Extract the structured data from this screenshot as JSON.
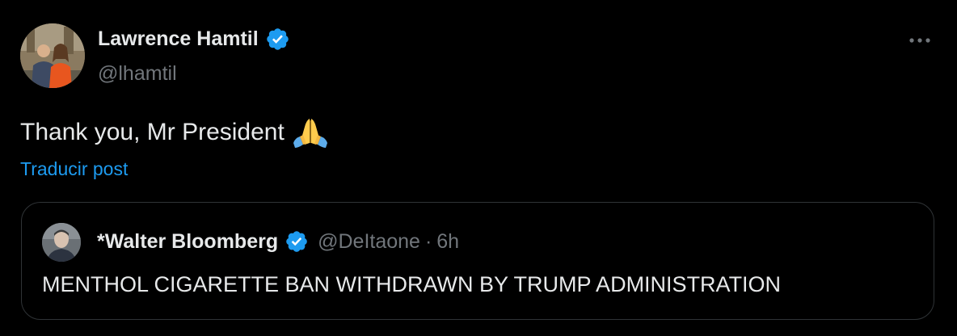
{
  "tweet": {
    "author_name": "Lawrence Hamtil",
    "author_handle": "@lhamtil",
    "text": "Thank you, Mr President",
    "emoji_icon": "folded-hands-emoji",
    "translate_link": "Traducir post",
    "more_icon": "more-options-icon"
  },
  "quote": {
    "author_name": "*Walter Bloomberg",
    "author_handle": "@DeItaone",
    "separator": "·",
    "time": "6h",
    "text": "MENTHOL CIGARETTE BAN WITHDRAWN BY TRUMP ADMINISTRATION"
  },
  "colors": {
    "background": "#000000",
    "primary_text": "#e7e9ea",
    "secondary_text": "#71767b",
    "link": "#1d9bf0",
    "verified_badge": "#1d9bf0",
    "border": "#2f3336"
  }
}
